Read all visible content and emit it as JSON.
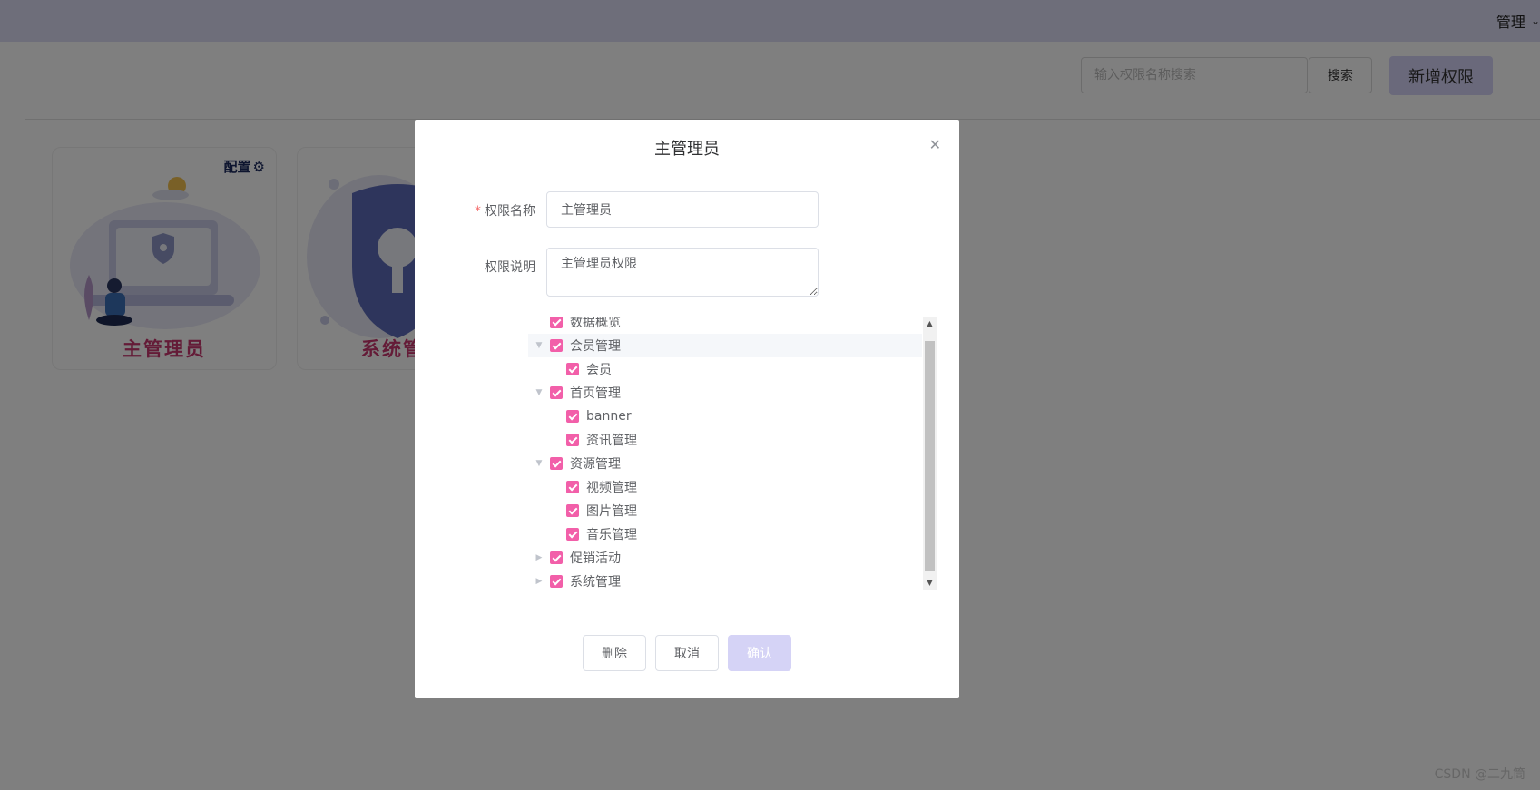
{
  "header": {
    "user_menu_label": "管理"
  },
  "toolbar": {
    "search_placeholder": "输入权限名称搜索",
    "search_label": "搜索",
    "add_label": "新增权限"
  },
  "cards": [
    {
      "title": "主管理员",
      "config_label": "配置"
    },
    {
      "title": "系统管"
    }
  ],
  "dialog": {
    "title": "主管理员",
    "name_label": "权限名称",
    "name_value": "主管理员",
    "desc_label": "权限说明",
    "desc_value": "主管理员权限",
    "tree": [
      {
        "label": "数据概览",
        "level": 1,
        "checked": true
      },
      {
        "label": "会员管理",
        "level": 1,
        "checked": true,
        "expanded": true
      },
      {
        "label": "会员",
        "level": 2,
        "checked": true
      },
      {
        "label": "首页管理",
        "level": 1,
        "checked": true,
        "expanded": true
      },
      {
        "label": "banner",
        "level": 2,
        "checked": true
      },
      {
        "label": "资讯管理",
        "level": 2,
        "checked": true
      },
      {
        "label": "资源管理",
        "level": 1,
        "checked": true,
        "expanded": true
      },
      {
        "label": "视频管理",
        "level": 2,
        "checked": true
      },
      {
        "label": "图片管理",
        "level": 2,
        "checked": true
      },
      {
        "label": "音乐管理",
        "level": 2,
        "checked": true
      },
      {
        "label": "促销活动",
        "level": 1,
        "checked": true,
        "expanded": false
      },
      {
        "label": "系统管理",
        "level": 1,
        "checked": true,
        "expanded": false
      }
    ],
    "delete_label": "删除",
    "cancel_label": "取消",
    "confirm_label": "确认"
  },
  "watermark": "CSDN @二九筒",
  "colors": {
    "accent": "#f25fa9",
    "primary_button": "#d5d3f6",
    "card_title": "#c8366f"
  }
}
